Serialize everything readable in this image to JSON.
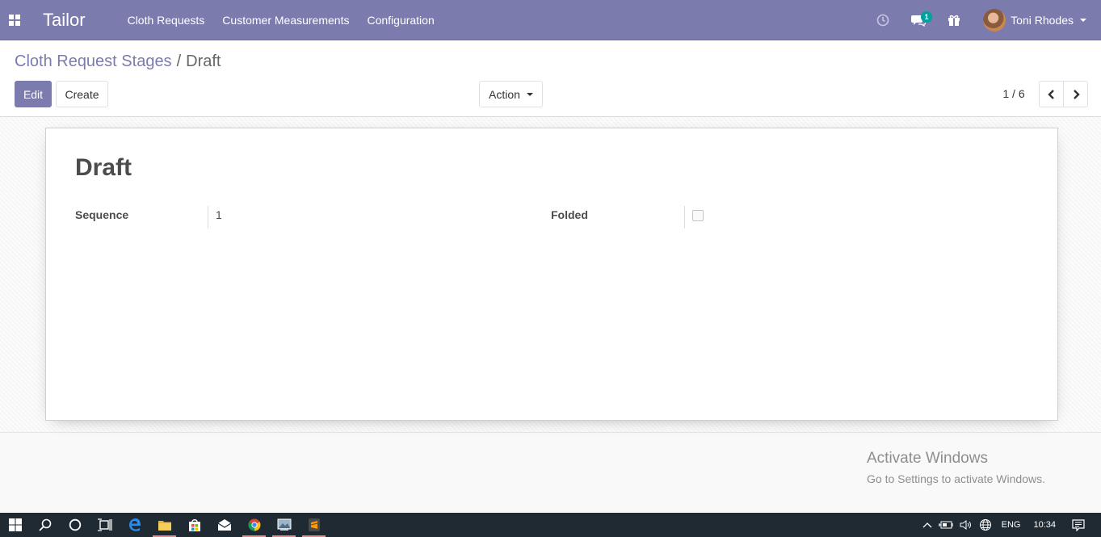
{
  "navbar": {
    "brand": "Tailor",
    "menu": [
      "Cloth Requests",
      "Customer Measurements",
      "Configuration"
    ],
    "messages_badge": "1",
    "user_name": "Toni Rhodes"
  },
  "breadcrumb": {
    "parent": "Cloth Request Stages",
    "separator": "/",
    "current": "Draft"
  },
  "toolbar": {
    "edit_label": "Edit",
    "create_label": "Create",
    "action_label": "Action"
  },
  "pager": {
    "value": "1 / 6"
  },
  "record": {
    "title": "Draft",
    "sequence_label": "Sequence",
    "sequence_value": "1",
    "folded_label": "Folded",
    "folded_checked": false
  },
  "watermark": {
    "title": "Activate Windows",
    "subtitle": "Go to Settings to activate Windows."
  },
  "taskbar": {
    "language": "ENG",
    "time": "10:34"
  },
  "colors": {
    "brand": "#7c7bad",
    "badge": "#00a09d",
    "taskbar": "#1f2a33"
  }
}
